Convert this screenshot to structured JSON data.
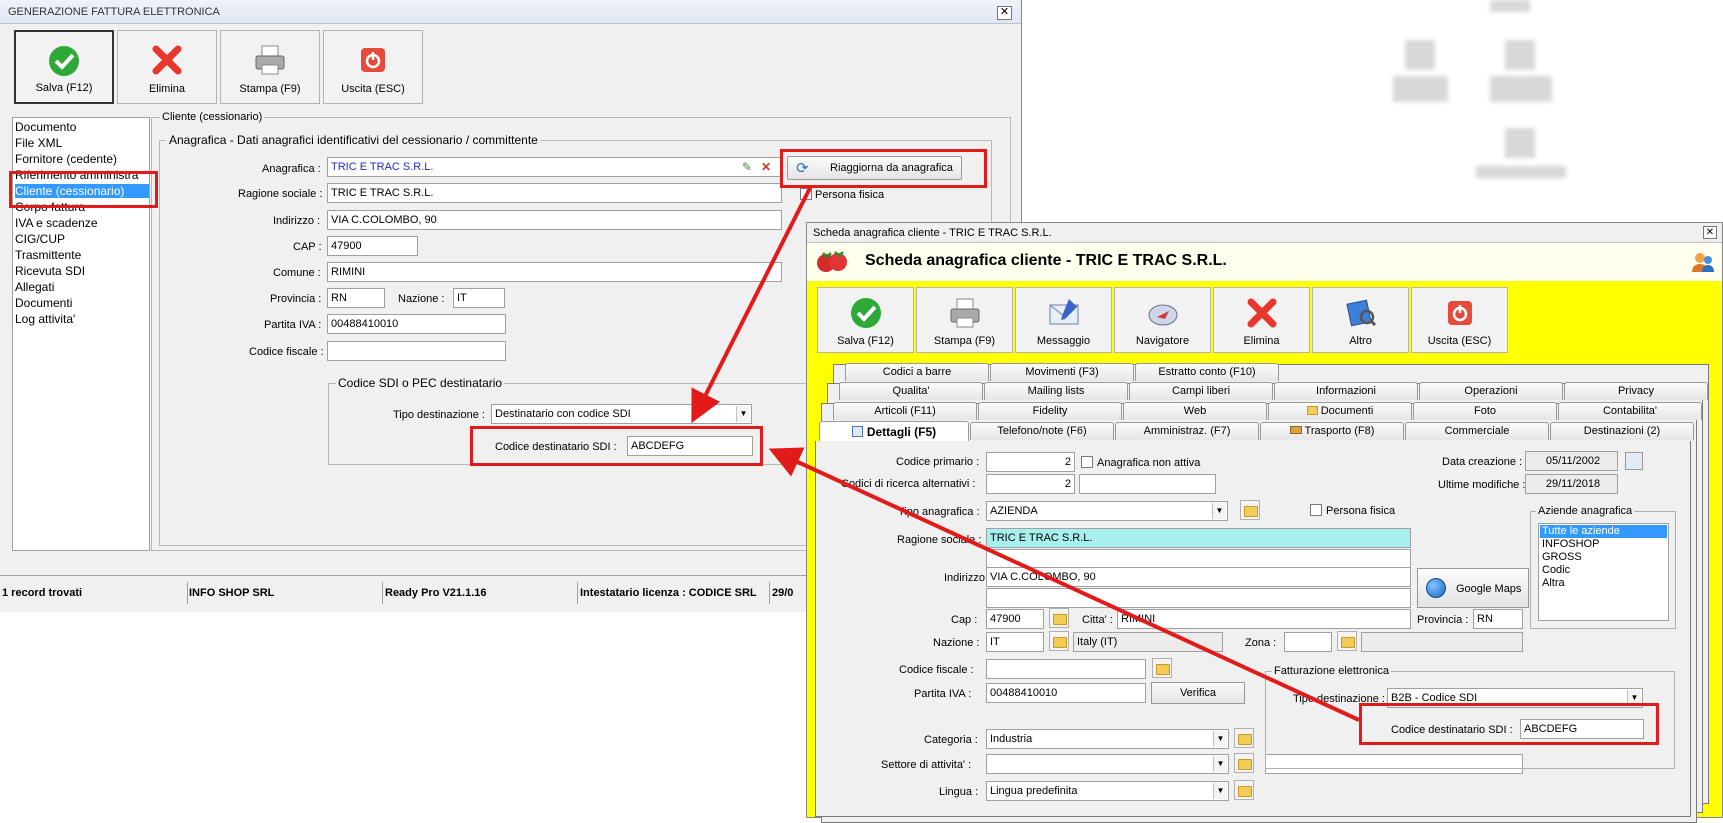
{
  "win1": {
    "title": "GENERAZIONE FATTURA ELETTRONICA",
    "toolbar": {
      "save": "Salva (F12)",
      "delete": "Elimina",
      "print": "Stampa (F9)",
      "exit": "Uscita (ESC)"
    },
    "nav": [
      "Documento",
      "File XML",
      "Fornitore (cedente)",
      "Riferimento amministra",
      "Cliente (cessionario)",
      "Corpo fattura",
      "IVA e scadenze",
      "CIG/CUP",
      "Trasmittente",
      "Ricevuta SDI",
      "Allegati",
      "Documenti",
      "Log attivita'"
    ],
    "panel_title": "Cliente (cessionario)",
    "group_title": "Anagrafica - Dati anagrafici identificativi del cessionario / committente",
    "labels": {
      "anagrafica": "Anagrafica :",
      "ragione": "Ragione sociale :",
      "indirizzo": "Indirizzo :",
      "cap": "CAP :",
      "comune": "Comune :",
      "provincia": "Provincia :",
      "nazione": "Nazione :",
      "piva": "Partita IVA :",
      "cf": "Codice fiscale :"
    },
    "values": {
      "anagrafica": "TRIC E TRAC S.R.L.",
      "ragione": "TRIC E TRAC S.R.L.",
      "indirizzo": "VIA C.COLOMBO, 90",
      "cap": "47900",
      "comune": "RIMINI",
      "provincia": "RN",
      "nazione": "IT",
      "piva": "00488410010",
      "cf": ""
    },
    "refresh_button": "Riaggiorna da anagrafica",
    "persona_fisica": "Persona fisica",
    "sdi_group": "Codice SDI o PEC destinatario",
    "tipo_label": "Tipo destinazione :",
    "tipo_value": "Destinatario con codice SDI",
    "codice_label": "Codice destinatario SDI :",
    "codice_value": "ABCDEFG",
    "status": [
      "1 record trovati",
      "INFO SHOP SRL",
      "Ready Pro V21.1.16",
      "Intestatario licenza : CODICE SRL",
      "29/0"
    ]
  },
  "win2": {
    "title": "Scheda anagrafica cliente - TRIC E TRAC S.R.L.",
    "header": "Scheda anagrafica cliente - TRIC E TRAC S.R.L.",
    "toolbar": {
      "save": "Salva (F12)",
      "print": "Stampa (F9)",
      "message": "Messaggio",
      "nav": "Navigatore",
      "delete": "Elimina",
      "other": "Altro",
      "exit": "Uscita (ESC)"
    },
    "tabs_row1": [
      "Codici a barre",
      "Movimenti (F3)",
      "Estratto conto (F10)"
    ],
    "tabs_row2": [
      "Qualita'",
      "Mailing lists",
      "Campi liberi",
      "Informazioni",
      "Operazioni",
      "Privacy"
    ],
    "tabs_row3": [
      "Articoli (F11)",
      "Fidelity",
      "Web",
      "Documenti",
      "Foto",
      "Contabilita'"
    ],
    "tabs_row4": [
      "Dettagli (F5)",
      "Telefono/note (F6)",
      "Amministraz. (F7)",
      "Trasporto (F8)",
      "Commerciale",
      "Destinazioni (2)"
    ],
    "labels": {
      "codice_primario": "Codice primario :",
      "codici_ricerca": "Codici di ricerca alternativi :",
      "anagrafica_non_attiva": "Anagrafica non attiva",
      "data_creazione": "Data creazione :",
      "ultime_modifiche": "Ultime modifiche :",
      "tipo_anagrafica": "Tipo anagrafica :",
      "persona_fisica": "Persona fisica",
      "ragione_sociale": "Ragione sociale :",
      "indirizzo": "Indirizzo :",
      "cap": "Cap :",
      "citta": "Citta' :",
      "provincia": "Provincia :",
      "nazione": "Nazione :",
      "zona": "Zona :",
      "codice_fiscale": "Codice fiscale :",
      "partita_iva": "Partita IVA :",
      "categoria": "Categoria :",
      "settore": "Settore di attivita' :",
      "lingua": "Lingua :"
    },
    "values": {
      "codice_primario": "2",
      "codici_ricerca": "2",
      "data_creazione": "05/11/2002",
      "ultime_modifiche": "29/11/2018",
      "tipo_anagrafica": "AZIENDA",
      "ragione_sociale": "TRIC E TRAC S.R.L.",
      "indirizzo": "VIA C.COLOMBO, 90",
      "cap": "47900",
      "citta": "RIMINI",
      "provincia": "RN",
      "nazione": "IT",
      "nazione_desc": "Italy (IT)",
      "partita_iva": "00488410010",
      "categoria": "Industria",
      "settore": "",
      "lingua": "Lingua predefinita"
    },
    "google_maps": "Google Maps",
    "verifica": "Verifica",
    "aziende_title": "Aziende anagrafica",
    "aziende": [
      "Tutte le aziende",
      "INFOSHOP",
      "GROSS",
      "Codic",
      "Altra"
    ],
    "fe_group": "Fatturazione elettronica",
    "fe_tipo_label": "Tipo destinazione :",
    "fe_tipo_value": "B2B - Codice SDI",
    "fe_codice_label": "Codice destinatario SDI :",
    "fe_codice_value": "ABCDEFG"
  },
  "colors": {
    "highlight_red": "#e31a1a",
    "form_yellow": "#ffff00",
    "selection_blue": "#3399ff"
  }
}
